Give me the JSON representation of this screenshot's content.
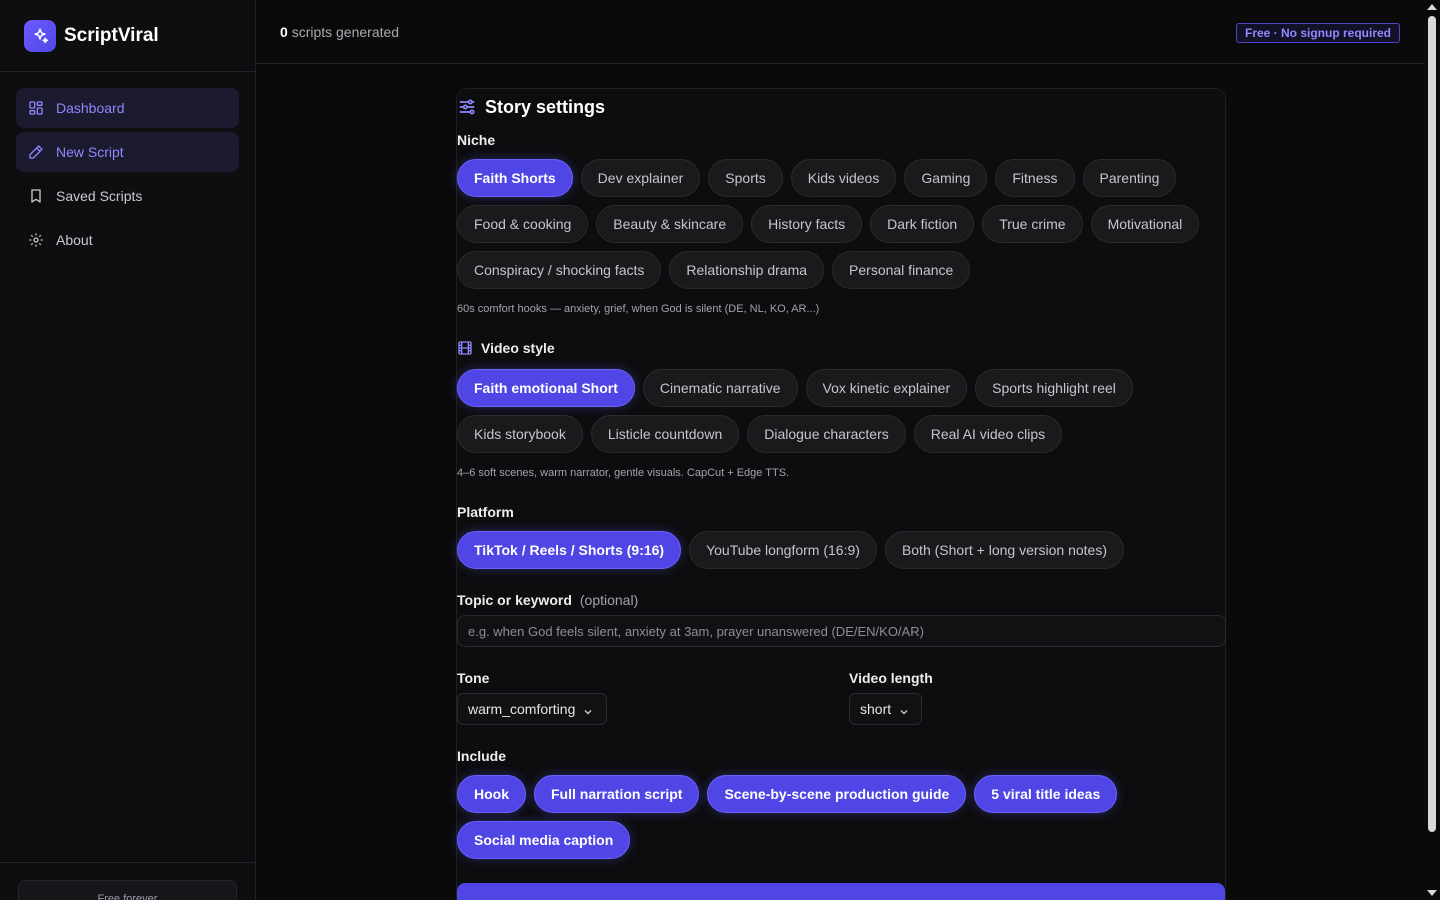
{
  "brand": {
    "name": "ScriptViral",
    "logo_icon": "sparkles-icon"
  },
  "sidebar": {
    "items": [
      {
        "label": "Dashboard",
        "icon": "grid-icon"
      },
      {
        "label": "New Script",
        "icon": "pencil-icon"
      },
      {
        "label": "Saved Scripts",
        "icon": "bookmark-icon"
      },
      {
        "label": "About",
        "icon": "gear-icon"
      }
    ],
    "footer_label": "Free forever"
  },
  "header": {
    "count": "0",
    "count_suffix": "scripts generated",
    "badge": "Free · No signup required"
  },
  "story": {
    "title": "Story settings",
    "niche": {
      "label": "Niche",
      "options": [
        "Faith Shorts",
        "Dev explainer",
        "Sports",
        "Kids videos",
        "Gaming",
        "Fitness",
        "Parenting",
        "Food & cooking",
        "Beauty & skincare",
        "History facts",
        "Dark fiction",
        "True crime",
        "Motivational",
        "Conspiracy / shocking facts",
        "Relationship drama",
        "Personal finance"
      ],
      "selected": "Faith Shorts",
      "hint": "60s comfort hooks — anxiety, grief, when God is silent (DE, NL, KO, AR...)"
    },
    "video_style": {
      "label": "Video style",
      "options": [
        "Faith emotional Short",
        "Cinematic narrative",
        "Vox kinetic explainer",
        "Sports highlight reel",
        "Kids storybook",
        "Listicle countdown",
        "Dialogue characters",
        "Real AI video clips"
      ],
      "selected": "Faith emotional Short",
      "hint": "4–6 soft scenes, warm narrator, gentle visuals. CapCut + Edge TTS."
    },
    "platform": {
      "label": "Platform",
      "options": [
        "TikTok / Reels / Shorts (9:16)",
        "YouTube longform (16:9)",
        "Both (Short + long version notes)"
      ],
      "selected": "TikTok / Reels / Shorts (9:16)"
    },
    "topic": {
      "label": "Topic or keyword",
      "optional": "(optional)",
      "value": "",
      "placeholder": "e.g. when God feels silent, anxiety at 3am, prayer unanswered (DE/EN/KO/AR)"
    },
    "tone": {
      "label": "Tone",
      "value": "warm_comforting"
    },
    "length": {
      "label": "Video length",
      "value": "short"
    },
    "include": {
      "label": "Include",
      "options": [
        "Hook",
        "Full narration script",
        "Scene-by-scene production guide",
        "5 viral title ideas",
        "Social media caption"
      ]
    }
  },
  "colors": {
    "accent": "#4f46e5",
    "background": "#0a0a0b",
    "active_nav_text": "#8f87ff"
  }
}
